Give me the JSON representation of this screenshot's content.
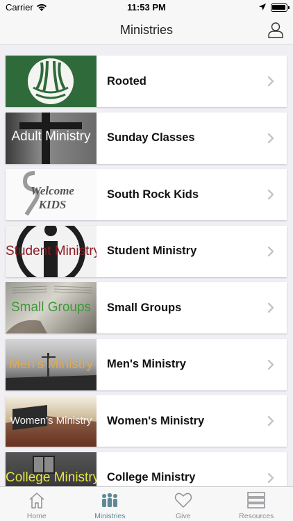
{
  "status_bar": {
    "carrier": "Carrier",
    "time": "11:53 PM"
  },
  "nav": {
    "title": "Ministries",
    "profile_icon": "person-icon"
  },
  "ministries": [
    {
      "label": "Rooted",
      "thumb_caption": ""
    },
    {
      "label": "Sunday Classes",
      "thumb_caption": "Adult Ministry"
    },
    {
      "label": "South Rock Kids",
      "thumb_caption": "Welcome KIDS"
    },
    {
      "label": "Student Ministry",
      "thumb_caption": "Student Ministry"
    },
    {
      "label": "Small Groups",
      "thumb_caption": "Small Groups"
    },
    {
      "label": "Men's Ministry",
      "thumb_caption": "Men's Ministry"
    },
    {
      "label": "Women's Ministry",
      "thumb_caption": "Women's Ministry"
    },
    {
      "label": "College Ministry",
      "thumb_caption": "College Ministry"
    }
  ],
  "tabs": [
    {
      "label": "Home",
      "icon": "home-icon",
      "active": false
    },
    {
      "label": "Ministries",
      "icon": "people-icon",
      "active": true
    },
    {
      "label": "Give",
      "icon": "heart-icon",
      "active": false
    },
    {
      "label": "Resources",
      "icon": "list-icon",
      "active": false
    }
  ],
  "colors": {
    "accent": "#5f8a94",
    "inactive": "#8e8e93",
    "background": "#efeff4"
  }
}
